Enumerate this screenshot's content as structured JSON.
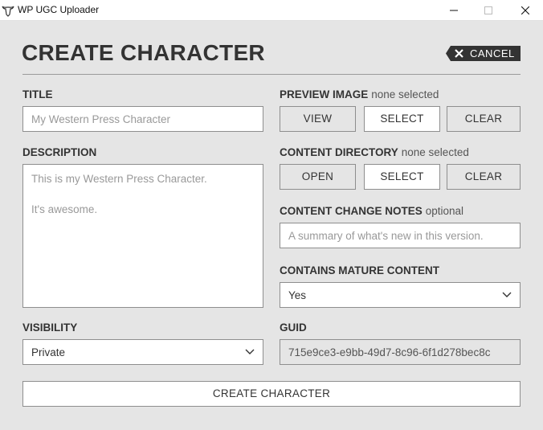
{
  "window": {
    "title": "WP UGC Uploader",
    "icon": "bull-skull-icon"
  },
  "header": {
    "title": "CREATE CHARACTER",
    "cancel_label": "CANCEL"
  },
  "title_field": {
    "label": "TITLE",
    "placeholder": "My Western Press Character"
  },
  "description_field": {
    "label": "DESCRIPTION",
    "placeholder_lines": [
      "This is my Western Press Character.",
      "",
      "It's awesome."
    ]
  },
  "visibility_field": {
    "label": "VISIBILITY",
    "selected": "Private"
  },
  "preview_image": {
    "label": "PREVIEW IMAGE",
    "status": "none selected",
    "buttons": [
      "VIEW",
      "SELECT",
      "CLEAR"
    ]
  },
  "content_directory": {
    "label": "CONTENT DIRECTORY",
    "status": "none selected",
    "buttons": [
      "OPEN",
      "SELECT",
      "CLEAR"
    ]
  },
  "change_notes": {
    "label": "CONTENT CHANGE NOTES",
    "status": "optional",
    "placeholder": "A summary of what's new in this version."
  },
  "mature_content": {
    "label": "CONTAINS MATURE CONTENT",
    "selected": "Yes"
  },
  "guid": {
    "label": "GUID",
    "value": "715e9ce3-e9bb-49d7-8c96-6f1d278bec8c"
  },
  "footer": {
    "create_label": "CREATE CHARACTER"
  },
  "colors": {
    "background": "#e5e5e5",
    "dark": "#333333",
    "border": "#8e8e8e"
  }
}
